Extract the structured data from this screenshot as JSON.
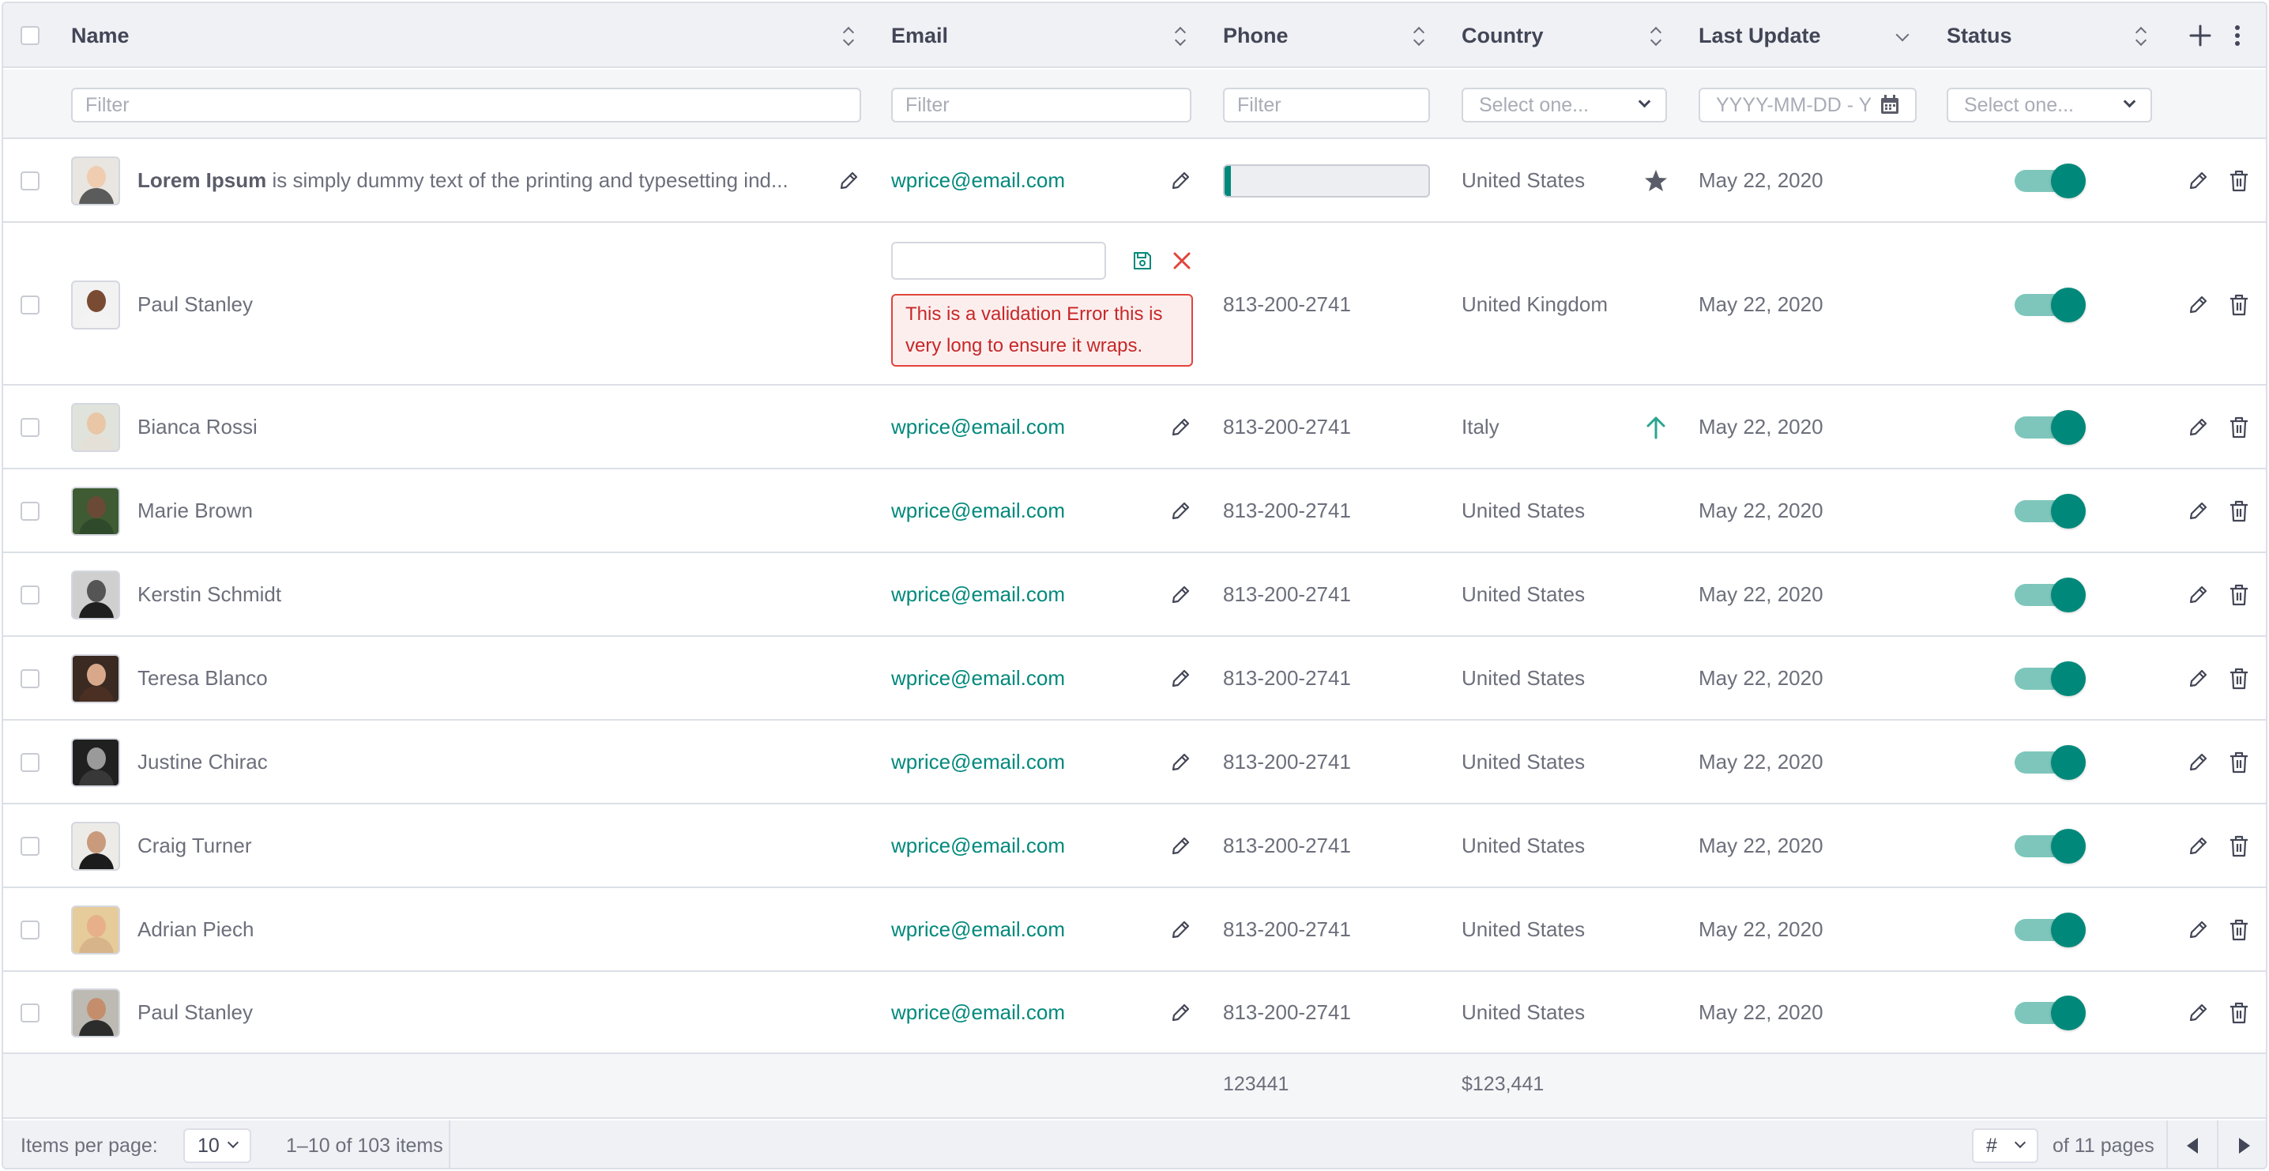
{
  "columns": {
    "name": "Name",
    "email": "Email",
    "phone": "Phone",
    "country": "Country",
    "last_update": "Last Update",
    "status": "Status"
  },
  "filters": {
    "name_placeholder": "Filter",
    "email_placeholder": "Filter",
    "phone_placeholder": "Filter",
    "country_placeholder": "Select one...",
    "date_placeholder": "YYYY-MM-DD - Y",
    "status_placeholder": "Select one..."
  },
  "rows": [
    {
      "name_bold": "Lorem Ipsum",
      "name": " is simply dummy text of the printing and typesetting ind...",
      "email": "wprice@email.com",
      "phone_progress": 0.03,
      "country": "United States",
      "country_icon": "star-icon",
      "date": "May 22, 2020",
      "status_on": true,
      "avatar_colors": [
        "#e9e5e0",
        "#f0cdb0",
        "#5b5b5b"
      ]
    },
    {
      "name": "Paul Stanley",
      "email_edit_value": "",
      "email_error": "This is a validation Error this is very long to ensure it wraps.",
      "phone": "813-200-2741",
      "country": "United Kingdom",
      "date": "May 22, 2020",
      "status_on": true,
      "avatar_colors": [
        "#f2f2f2",
        "#7a4b33",
        "#f3f3f3"
      ]
    },
    {
      "name": "Bianca Rossi",
      "email": "wprice@email.com",
      "phone": "813-200-2741",
      "country": "Italy",
      "country_icon": "arrow-up-icon",
      "date": "May 22, 2020",
      "status_on": true,
      "avatar_colors": [
        "#dfe3dc",
        "#e9c6a5",
        "#e4e0d8"
      ]
    },
    {
      "name": "Marie Brown",
      "email": "wprice@email.com",
      "phone": "813-200-2741",
      "country": "United States",
      "date": "May 22, 2020",
      "status_on": true,
      "avatar_colors": [
        "#3e5b33",
        "#6a4a36",
        "#2f4a2a"
      ]
    },
    {
      "name": "Kerstin Schmidt",
      "email": "wprice@email.com",
      "phone": "813-200-2741",
      "country": "United States",
      "date": "May 22, 2020",
      "status_on": true,
      "avatar_colors": [
        "#cfcfcf",
        "#555555",
        "#1f1f1f"
      ]
    },
    {
      "name": "Teresa Blanco",
      "email": "wprice@email.com",
      "phone": "813-200-2741",
      "country": "United States",
      "date": "May 22, 2020",
      "status_on": true,
      "avatar_colors": [
        "#3a2a22",
        "#d9a88a",
        "#4a2f22"
      ]
    },
    {
      "name": "Justine Chirac",
      "email": "wprice@email.com",
      "phone": "813-200-2741",
      "country": "United States",
      "date": "May 22, 2020",
      "status_on": true,
      "avatar_colors": [
        "#202020",
        "#9a9a9a",
        "#383838"
      ]
    },
    {
      "name": "Craig Turner",
      "email": "wprice@email.com",
      "phone": "813-200-2741",
      "country": "United States",
      "date": "May 22, 2020",
      "status_on": true,
      "avatar_colors": [
        "#ecebe8",
        "#c99a7c",
        "#1c1c1c"
      ]
    },
    {
      "name": "Adrian Piech",
      "email": "wprice@email.com",
      "phone": "813-200-2741",
      "country": "United States",
      "date": "May 22, 2020",
      "status_on": true,
      "avatar_colors": [
        "#e5cc9a",
        "#e7b08a",
        "#d7b48a"
      ]
    },
    {
      "name": "Paul Stanley",
      "email": "wprice@email.com",
      "phone": "813-200-2741",
      "country": "United States",
      "date": "May 22, 2020",
      "status_on": true,
      "avatar_colors": [
        "#bdbab4",
        "#c48e6c",
        "#2c2c2c"
      ]
    }
  ],
  "summary": {
    "phone_total": "123441",
    "country_total": "$123,441"
  },
  "pager": {
    "items_per_page_label": "Items per page:",
    "items_per_page_value": "10",
    "range_text": "1–10 of 103 items",
    "page_input": "#",
    "of_pages": "of 11 pages"
  },
  "colors": {
    "accent": "#00897b",
    "error": "#e0453b",
    "toggle_track": "#7ec6bb"
  }
}
